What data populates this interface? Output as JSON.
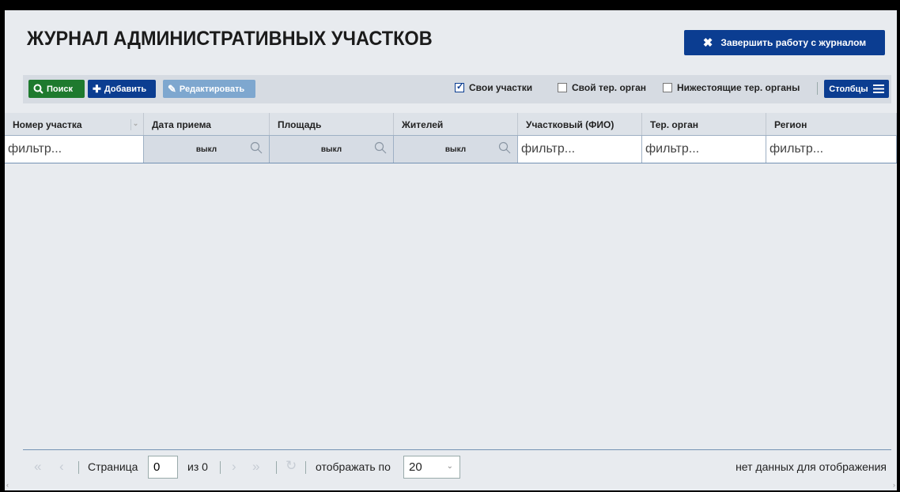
{
  "page": {
    "title": "ЖУРНАЛ АДМИНИСТРАТИВНЫХ УЧАСТКОВ",
    "finish_label": "Завершить работу с журналом"
  },
  "toolbar": {
    "search_label": "Поиск",
    "add_label": "Добавить",
    "edit_label": "Редактировать",
    "own_sites_label": "Свои участки",
    "own_sites_checked": true,
    "own_terorgan_label": "Свой тер. орган",
    "own_terorgan_checked": false,
    "lower_terorgans_label": "Нижестоящие тер. органы",
    "lower_terorgans_checked": false,
    "columns_label": "Столбцы"
  },
  "grid": {
    "columns": [
      {
        "label": "Номер участка"
      },
      {
        "label": "Дата приема"
      },
      {
        "label": "Площадь"
      },
      {
        "label": "Жителей"
      },
      {
        "label": "Участковый (ФИО)"
      },
      {
        "label": "Тер. орган"
      },
      {
        "label": "Регион"
      }
    ],
    "filters": {
      "text_placeholder": "фильтр...",
      "off_label": "выкл"
    },
    "rows": []
  },
  "footer": {
    "page_label": "Страница",
    "page_value": "0",
    "of_label": "из 0",
    "show_by_label": "отображать по",
    "page_size": "20",
    "status": "нет данных для отображения"
  },
  "icons": {
    "accent": "#0b3d91",
    "search_green": "#1e7a2e",
    "edit_light": "#7ea7cf"
  }
}
